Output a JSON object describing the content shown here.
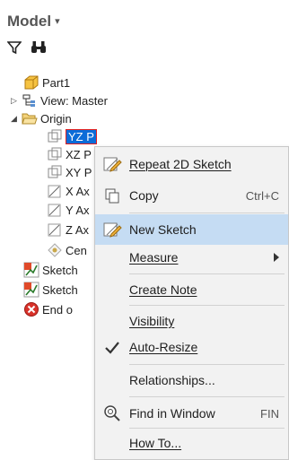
{
  "panel": {
    "title": "Model",
    "caret": "▾"
  },
  "toolbar": {
    "filter_icon": "filter-icon",
    "find_icon": "binoculars-icon"
  },
  "tree": {
    "part": "Part1",
    "view": "View: Master",
    "origin": "Origin",
    "yz_plane": "YZ P",
    "xz_plane": "XZ P",
    "xy_plane": "XY P",
    "x_axis": "X Ax",
    "y_axis": "Y Ax",
    "z_axis": "Z Ax",
    "center": "Cen",
    "sketch1": "Sketch",
    "sketch2": "Sketch",
    "end": "End o"
  },
  "menu": {
    "repeat_2d_sketch": "Repeat 2D Sketch",
    "copy": "Copy",
    "copy_shortcut": "Ctrl+C",
    "new_sketch": "New Sketch",
    "measure": "Measure",
    "create_note": "Create Note",
    "visibility": "Visibility",
    "auto_resize": "Auto-Resize",
    "relationships": "Relationships...",
    "find_in_window": "Find in Window",
    "find_shortcut": "FIN",
    "how_to": "How To..."
  },
  "colors": {
    "selection": "#0b6cd8",
    "menu_highlight": "#c5dcf3",
    "menu_bg": "#f2f2f2"
  }
}
